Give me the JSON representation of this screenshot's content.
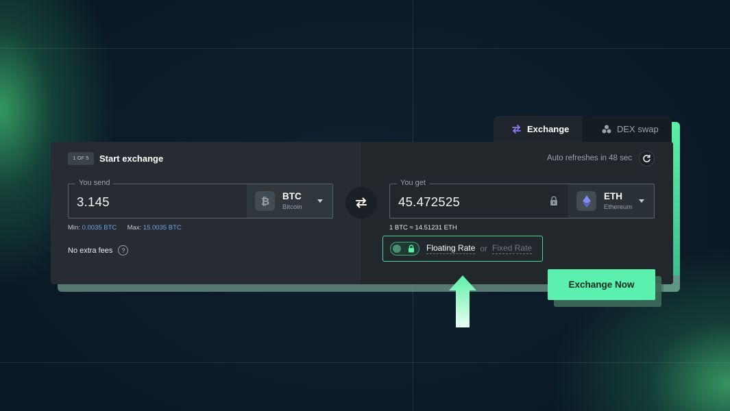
{
  "tabs": [
    {
      "label": "Exchange",
      "icon": "swap-arrows-icon",
      "active": true
    },
    {
      "label": "DEX swap",
      "icon": "dex-circles-icon",
      "active": false
    }
  ],
  "header": {
    "step_badge": "1 OF 5",
    "title": "Start exchange",
    "refresh_text": "Auto refreshes in 48 sec"
  },
  "send": {
    "label": "You send",
    "amount": "3.145",
    "coin_code": "BTC",
    "coin_name": "Bitcoin",
    "min_label": "Min:",
    "min_value": "0.0035 BTC",
    "max_label": "Max:",
    "max_value": "15.0035 BTC"
  },
  "get": {
    "label": "You get",
    "amount": "45.472525",
    "coin_code": "ETH",
    "coin_name": "Ethereum",
    "rate_text": "1 BTC  ≈  14.51231 ETH"
  },
  "fees_text": "No extra fees",
  "help_glyph": "?",
  "rate_type": {
    "floating_label": "Floating Rate",
    "or_label": "or",
    "fixed_label": "Fixed Rate",
    "selected": "floating"
  },
  "cta_label": "Exchange Now",
  "colors": {
    "accent": "#5bf0b0",
    "link_blue": "#6fa3e8",
    "card_bg": "#262c31",
    "page_bg": "#0b1a26"
  }
}
